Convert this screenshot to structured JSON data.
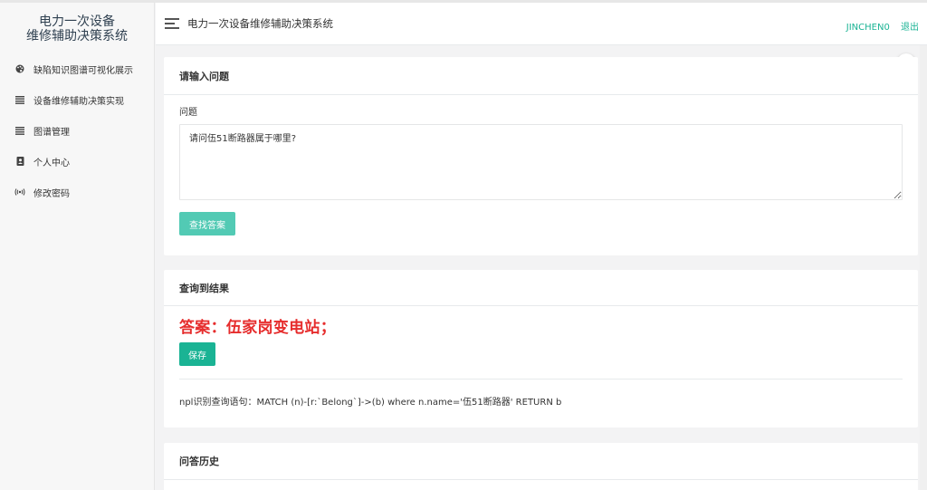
{
  "sidebar": {
    "brand_line1": "电力一次设备",
    "brand_line2": "维修辅助决策系统",
    "items": [
      {
        "label": "缺陷知识图谱可视化展示",
        "icon": "palette-icon",
        "glyph": "🎨"
      },
      {
        "label": "设备维修辅助决策实现",
        "icon": "list-icon",
        "glyph": "≣"
      },
      {
        "label": "图谱管理",
        "icon": "list-icon",
        "glyph": "≣"
      },
      {
        "label": "个人中心",
        "icon": "address-book-icon",
        "glyph": "▦"
      },
      {
        "label": "修改密码",
        "icon": "broadcast-icon",
        "glyph": "(•)"
      }
    ]
  },
  "header": {
    "title": "电力一次设备维修辅助决策系统",
    "user": "JINCHEN0",
    "logout": "退出"
  },
  "float_icon": "Y",
  "input_card": {
    "title": "请输入问题",
    "field_label": "问题",
    "question_value": "请问伍51断路器属于哪里?",
    "submit_label": "查找答案"
  },
  "result_card": {
    "title": "查询到结果",
    "answer": "答案：伍家岗变电站；",
    "save_label": "保存",
    "npl_text": "npl识别查询语句：MATCH (n)-[r:`Belong`]->(b) where n.name='伍51断路器' RETURN b"
  },
  "history_card": {
    "title": "问答历史"
  },
  "colors": {
    "accent": "#1ab394",
    "answer": "#e62d2d",
    "brand_text": "#2f4050"
  }
}
